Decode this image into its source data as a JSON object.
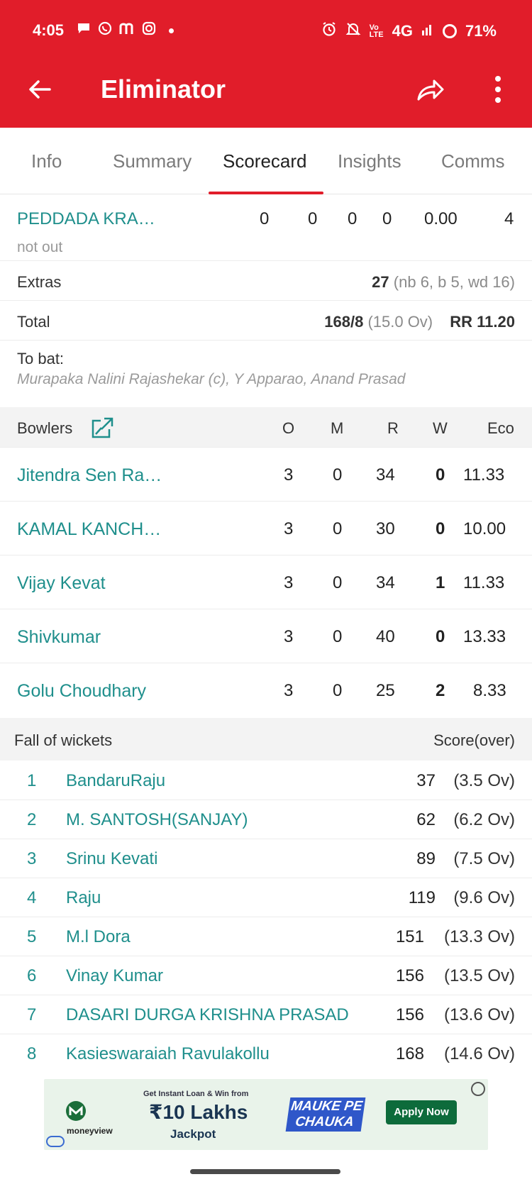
{
  "status_bar": {
    "time": "4:05",
    "network": "4G",
    "battery": "71%"
  },
  "app_bar": {
    "title": "Eliminator"
  },
  "tabs": [
    {
      "label": "Info"
    },
    {
      "label": "Summary"
    },
    {
      "label": "Scorecard",
      "active": true
    },
    {
      "label": "Insights"
    },
    {
      "label": "Comms"
    }
  ],
  "batsman": {
    "name": "PEDDADA KRA…",
    "status": "not out",
    "r": "0",
    "b": "0",
    "fours": "0",
    "sixes": "0",
    "sr": "0.00",
    "extra_col": "4"
  },
  "extras": {
    "label": "Extras",
    "value": "27",
    "detail": "(nb 6, b 5, wd 16)"
  },
  "total": {
    "label": "Total",
    "score": "168/8",
    "overs": "(15.0 Ov)",
    "rr": "RR 11.20"
  },
  "to_bat": {
    "label": "To bat:",
    "players": "Murapaka Nalini Rajashekar (c), Y Apparao, Anand Prasad"
  },
  "bowlers": {
    "header": {
      "label": "Bowlers",
      "o": "O",
      "m": "M",
      "r": "R",
      "w": "W",
      "eco": "Eco"
    },
    "rows": [
      {
        "name": "Jitendra Sen Ra…",
        "o": "3",
        "m": "0",
        "r": "34",
        "w": "0",
        "eco": "11.33"
      },
      {
        "name": "KAMAL KANCH…",
        "o": "3",
        "m": "0",
        "r": "30",
        "w": "0",
        "eco": "10.00"
      },
      {
        "name": "Vijay Kevat",
        "o": "3",
        "m": "0",
        "r": "34",
        "w": "1",
        "eco": "11.33"
      },
      {
        "name": "Shivkumar",
        "o": "3",
        "m": "0",
        "r": "40",
        "w": "0",
        "eco": "13.33"
      },
      {
        "name": "Golu Choudhary",
        "o": "3",
        "m": "0",
        "r": "25",
        "w": "2",
        "eco": "8.33"
      }
    ]
  },
  "fall_of_wickets": {
    "header": {
      "label": "Fall of wickets",
      "right": "Score(over)"
    },
    "rows": [
      {
        "idx": "1",
        "name": "BandaruRaju",
        "score": "37",
        "over": "(3.5 Ov)"
      },
      {
        "idx": "2",
        "name": "M. SANTOSH(SANJAY)",
        "score": "62",
        "over": "(6.2 Ov)"
      },
      {
        "idx": "3",
        "name": "Srinu Kevati",
        "score": "89",
        "over": "(7.5 Ov)"
      },
      {
        "idx": "4",
        "name": "Raju",
        "score": "119",
        "over": "(9.6 Ov)"
      },
      {
        "idx": "5",
        "name": "M.l Dora",
        "score": "151",
        "over": "(13.3 Ov)"
      },
      {
        "idx": "6",
        "name": "Vinay Kumar",
        "score": "156",
        "over": "(13.5 Ov)"
      },
      {
        "idx": "7",
        "name": "DASARI DURGA KRISHNA PRASAD",
        "score": "156",
        "over": "(13.6 Ov)"
      },
      {
        "idx": "8",
        "name": "Kasieswaraiah Ravulakollu",
        "score": "168",
        "over": "(14.6 Ov)"
      }
    ]
  },
  "ad": {
    "brand": "moneyview",
    "line1": "Get Instant Loan & Win from",
    "amount": "₹10 Lakhs",
    "jackpot": "Jackpot",
    "promo": "MAUKE PE CHAUKA",
    "cta": "Apply Now"
  },
  "colors": {
    "brand_red": "#e11d2a",
    "teal": "#1f8f8c"
  }
}
